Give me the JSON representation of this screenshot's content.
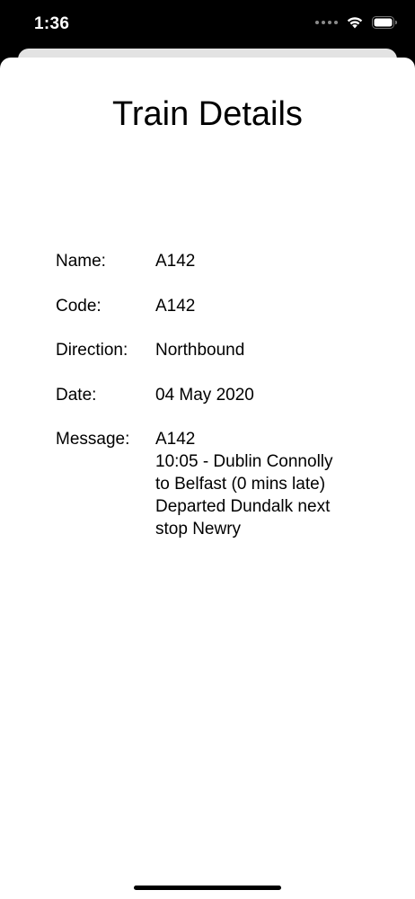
{
  "status_bar": {
    "time": "1:36"
  },
  "page": {
    "title": "Train Details"
  },
  "details": [
    {
      "label": "Name:",
      "value": "A142"
    },
    {
      "label": "Code:",
      "value": "A142"
    },
    {
      "label": "Direction:",
      "value": "Northbound"
    },
    {
      "label": "Date:",
      "value": "04 May 2020"
    },
    {
      "label": "Message:",
      "value": "A142\n10:05 - Dublin Connolly\nto Belfast (0 mins late)\nDeparted Dundalk next\nstop Newry"
    }
  ]
}
